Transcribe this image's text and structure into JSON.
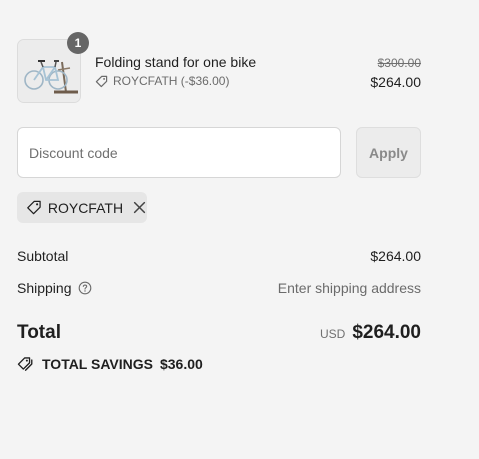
{
  "line_item": {
    "quantity": "1",
    "title": "Folding stand for one bike",
    "discount_note": "ROYCFATH (-$36.00)",
    "original_price": "$300.00",
    "final_price": "$264.00",
    "image_alt": "bike-stand-thumbnail"
  },
  "discount": {
    "placeholder": "Discount code",
    "value": "",
    "apply_label": "Apply"
  },
  "applied_code": {
    "label": "ROYCFATH"
  },
  "totals": {
    "subtotal_label": "Subtotal",
    "subtotal_value": "$264.00",
    "shipping_label": "Shipping",
    "shipping_value": "Enter shipping address",
    "total_label": "Total",
    "currency": "USD",
    "total_value": "$264.00",
    "savings_label": "TOTAL SAVINGS",
    "savings_value": "$36.00"
  },
  "icons": {
    "tag": "tag-icon",
    "remove": "close-icon",
    "help": "help-circle-icon",
    "savings": "tags-icon"
  },
  "colors": {
    "background": "#f4f4f4",
    "badge": "#666666",
    "muted_text": "#707070",
    "chip_background": "#e6e6e6"
  }
}
